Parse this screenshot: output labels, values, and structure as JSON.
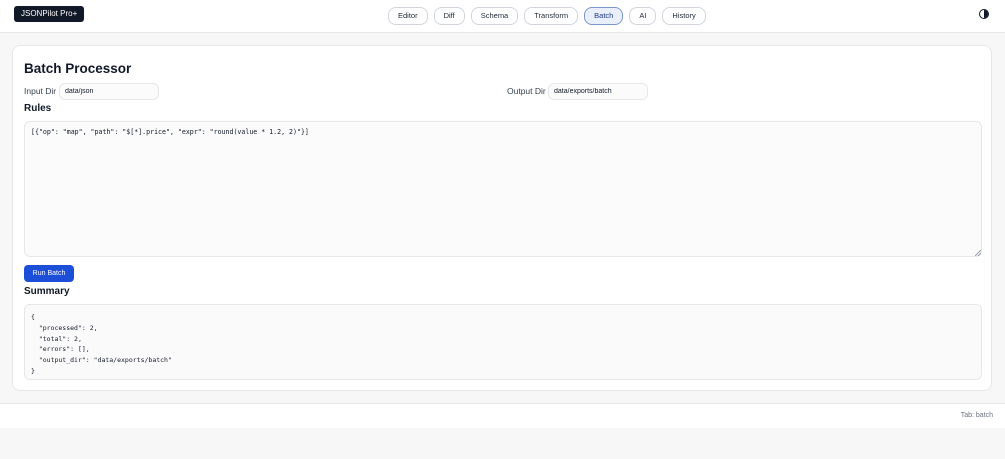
{
  "app": {
    "brand": "JSONPilot Pro+",
    "theme_icon": "contrast-icon"
  },
  "nav": {
    "tabs": [
      {
        "label": "Editor",
        "active": false
      },
      {
        "label": "Diff",
        "active": false
      },
      {
        "label": "Schema",
        "active": false
      },
      {
        "label": "Transform",
        "active": false
      },
      {
        "label": "Batch",
        "active": true
      },
      {
        "label": "AI",
        "active": false
      },
      {
        "label": "History",
        "active": false
      }
    ]
  },
  "batch": {
    "title": "Batch Processor",
    "input_dir_label": "Input Dir",
    "input_dir_value": "data/json",
    "output_dir_label": "Output Dir",
    "output_dir_value": "data/exports/batch",
    "rules_title": "Rules",
    "rules_value": "[{\"op\": \"map\", \"path\": \"$[*].price\", \"expr\": \"round(value * 1.2, 2)\"}]",
    "run_label": "Run Batch",
    "summary_title": "Summary",
    "summary_value": "{\n  \"processed\": 2,\n  \"total\": 2,\n  \"errors\": [],\n  \"output_dir\": \"data/exports/batch\"\n}"
  },
  "footer": {
    "status": "Tab: batch"
  },
  "colors": {
    "accent": "#1d4ed8",
    "active_tab_bg": "#eaf0fb",
    "brand_bg": "#111827"
  }
}
